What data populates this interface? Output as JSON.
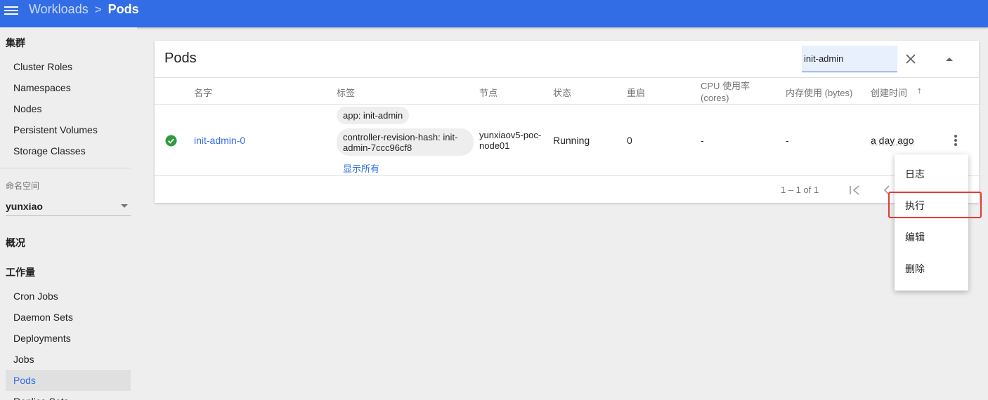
{
  "topbar": {
    "breadcrumb_parent": "Workloads",
    "breadcrumb_separator": ">",
    "breadcrumb_current": "Pods"
  },
  "sidebar": {
    "cluster_header": "集群",
    "cluster_items": [
      "Cluster Roles",
      "Namespaces",
      "Nodes",
      "Persistent Volumes",
      "Storage Classes"
    ],
    "namespace_label": "命名空间",
    "namespace_value": "yunxiao",
    "overview_header": "概况",
    "workloads_header": "工作量",
    "workload_items": [
      "Cron Jobs",
      "Daemon Sets",
      "Deployments",
      "Jobs",
      "Pods",
      "Replica Sets"
    ],
    "active_item": "Pods"
  },
  "card": {
    "title": "Pods",
    "search_value": "init-admin",
    "columns": [
      "名字",
      "标签",
      "节点",
      "状态",
      "重启",
      "CPU 使用率 (cores)",
      "内存使用 (bytes)",
      "创建时间"
    ],
    "sort_indicator": "↑",
    "rows": [
      {
        "status_icon": "check-circle-icon",
        "name": "init-admin-0",
        "labels": [
          "app: init-admin",
          "controller-revision-hash: init-admin-7ccc96cf8"
        ],
        "show_all": "显示所有",
        "node": "yunxiaov5-poc-node01",
        "status": "Running",
        "restarts": "0",
        "cpu": "-",
        "memory": "-",
        "created": "a day ago"
      }
    ],
    "pagination": "1 – 1 of 1"
  },
  "menu": {
    "items": [
      "日志",
      "执行",
      "编辑",
      "删除"
    ],
    "highlighted": "执行"
  },
  "colors": {
    "topbar": "#326de6",
    "link": "#326de6",
    "success": "#2e9c3e",
    "highlight_border": "#e53935"
  }
}
